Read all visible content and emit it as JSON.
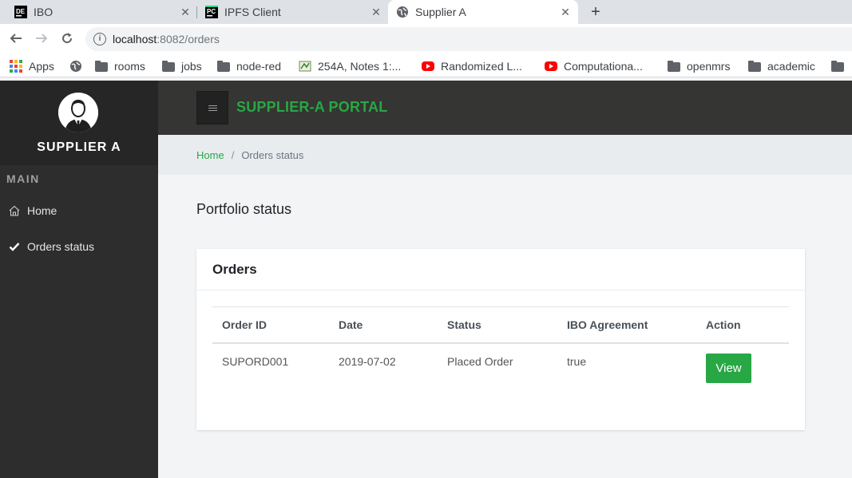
{
  "browser": {
    "tabs": [
      {
        "label": "IBO",
        "icon": "datagrip-icon"
      },
      {
        "label": "IPFS Client",
        "icon": "pycharm-icon"
      },
      {
        "label": "Supplier A",
        "icon": "globe-icon"
      }
    ],
    "address": {
      "host": "localhost",
      "path": ":8082/orders"
    },
    "bookmarks": [
      {
        "label": "Apps",
        "icon": "apps-grid-icon"
      },
      {
        "label": "",
        "icon": "globe-icon"
      },
      {
        "label": "rooms",
        "icon": "folder-icon"
      },
      {
        "label": "jobs",
        "icon": "folder-icon"
      },
      {
        "label": "node-red",
        "icon": "folder-icon"
      },
      {
        "label": "254A, Notes 1:...",
        "icon": "site-icon"
      },
      {
        "label": "Randomized L...",
        "icon": "youtube-icon"
      },
      {
        "label": "Computationa...",
        "icon": "youtube-icon"
      },
      {
        "label": "openmrs",
        "icon": "folder-icon"
      },
      {
        "label": "academic",
        "icon": "folder-icon"
      }
    ]
  },
  "sidebar": {
    "profile_name": "SUPPLIER A",
    "section": "MAIN",
    "items": [
      {
        "label": "Home",
        "icon": "home-icon"
      },
      {
        "label": "Orders status",
        "icon": "check-icon"
      }
    ]
  },
  "header": {
    "title": "SUPPLIER-A PORTAL"
  },
  "breadcrumb": {
    "home": "Home",
    "separator": "/",
    "current": "Orders status"
  },
  "page_title": "Portfolio status",
  "orders": {
    "title": "Orders",
    "columns": [
      "Order ID",
      "Date",
      "Status",
      "IBO Agreement",
      "Action"
    ],
    "rows": [
      {
        "order_id": "SUPORD001",
        "date": "2019-07-02",
        "status": "Placed Order",
        "ibo_agreement": "true",
        "action": "View"
      }
    ]
  },
  "colors": {
    "accent": "#28a745",
    "sidebar": "#2d2d2d",
    "header": "#353533"
  }
}
